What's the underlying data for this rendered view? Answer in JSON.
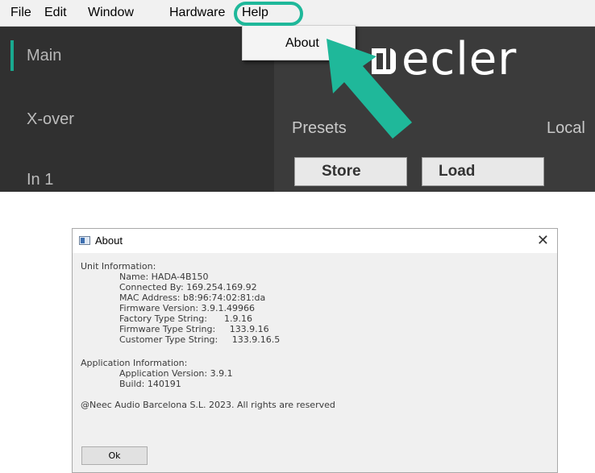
{
  "menubar": {
    "items": [
      "File",
      "Edit",
      "Window",
      "Hardware",
      "Help"
    ]
  },
  "help_menu": {
    "items": [
      "About"
    ]
  },
  "sidebar": {
    "items": [
      {
        "label": "Main",
        "active": true
      },
      {
        "label": "X-over",
        "active": false
      },
      {
        "label": "In 1",
        "active": false
      }
    ]
  },
  "content": {
    "logo_text": "ecler",
    "presets_label": "Presets",
    "local_label": "Local",
    "store_label": "Store",
    "load_label": "Load"
  },
  "colors": {
    "accent": "#1fb89a",
    "sidebar_bg": "#303030",
    "content_bg": "#3b3b3b"
  },
  "about_dialog": {
    "title": "About",
    "close_glyph": "✕",
    "unit_header": "Unit Information:",
    "unit_lines": [
      "Name: HADA-4B150",
      "Connected By: 169.254.169.92",
      "MAC Address: b8:96:74:02:81:da",
      "Firmware Version: 3.9.1.49966",
      "Factory Type String:      1.9.16",
      "Firmware Type String:     133.9.16",
      "Customer Type String:     133.9.16.5"
    ],
    "app_header": "Application Information:",
    "app_lines": [
      "Application Version: 3.9.1",
      "Build: 140191"
    ],
    "copyright": "@Neec Audio Barcelona S.L. 2023. All rights are reserved",
    "ok_label": "Ok"
  }
}
